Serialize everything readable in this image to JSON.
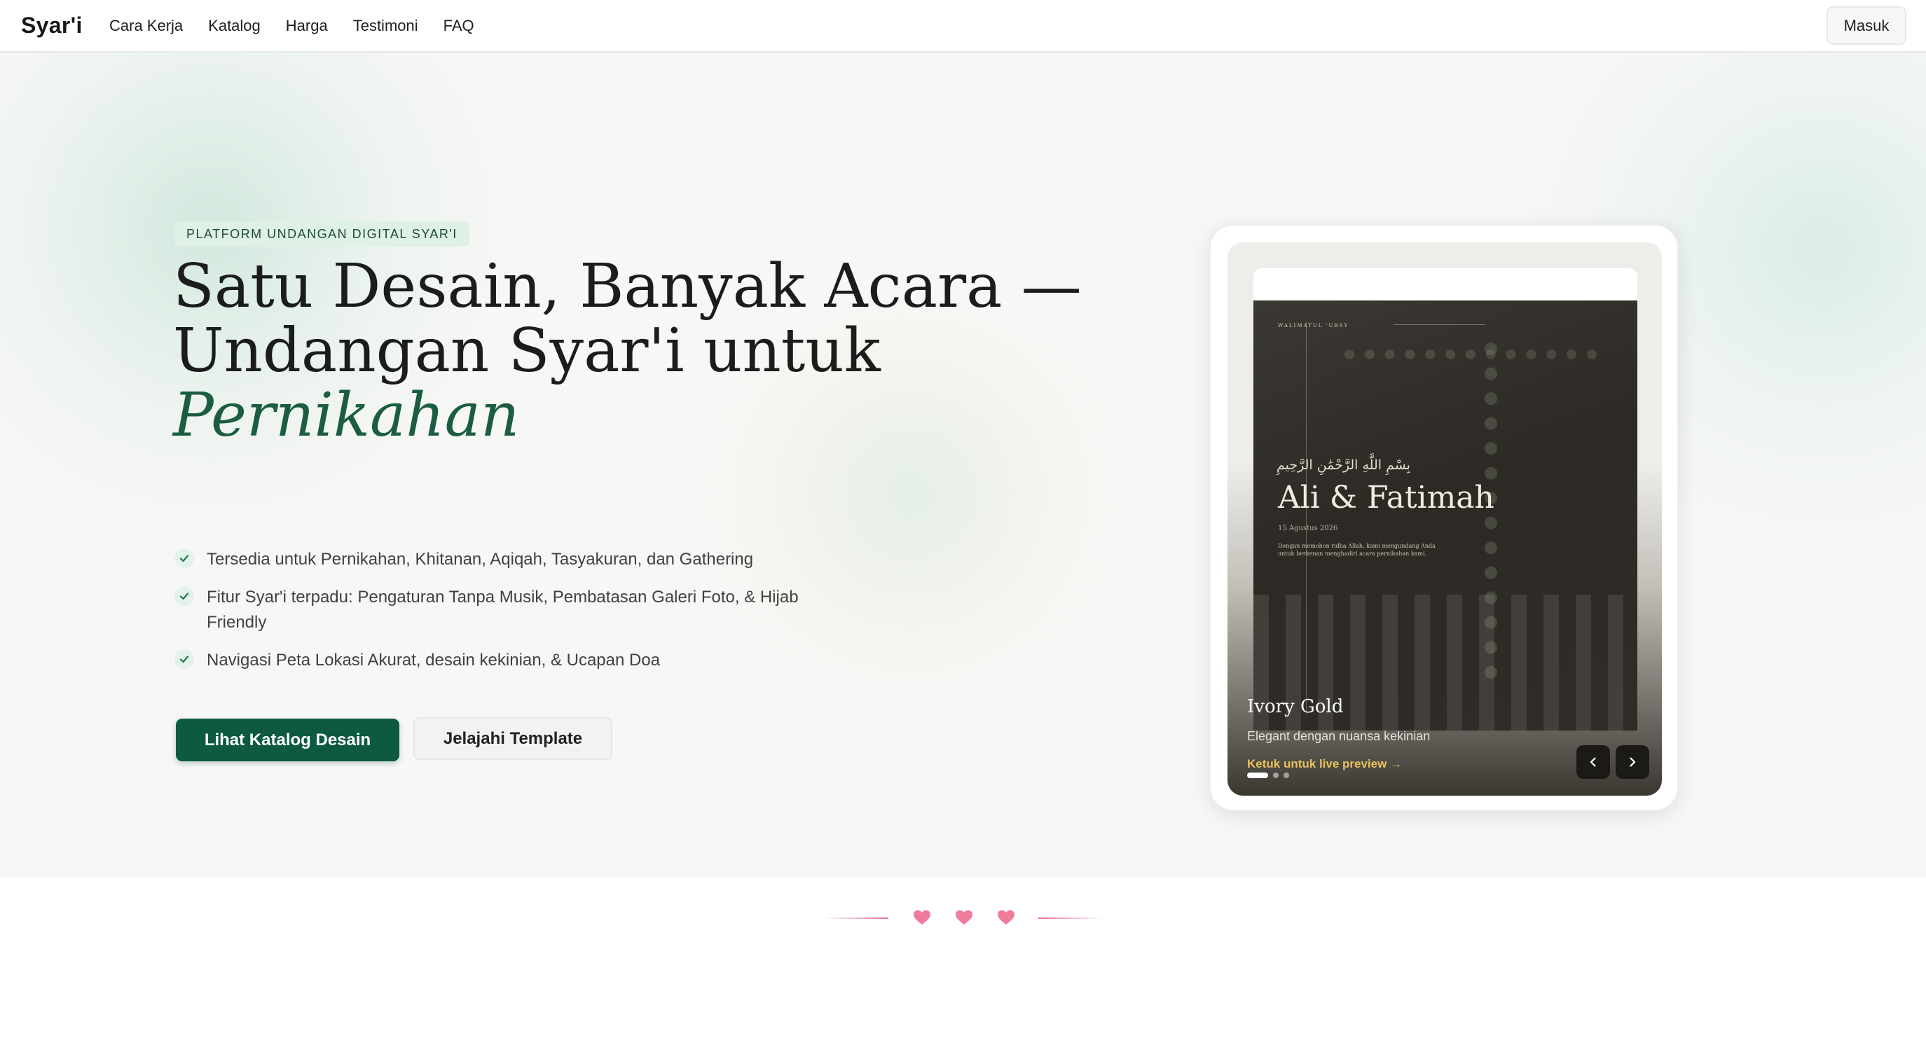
{
  "nav": {
    "brand": "Syar'i",
    "links": [
      "Cara Kerja",
      "Katalog",
      "Harga",
      "Testimoni",
      "FAQ"
    ],
    "login_label": "Masuk"
  },
  "hero": {
    "badge": "PLATFORM UNDANGAN DIGITAL SYAR'I",
    "headline_line1": "Satu Desain, Banyak Acara —",
    "headline_line2": "Undangan Syar'i untuk",
    "headline_accent": "Pernikahan",
    "features": [
      "Tersedia untuk Pernikahan, Khitanan, Aqiqah, Tasyakuran, dan Gathering",
      "Fitur Syar'i terpadu: Pengaturan Tanpa Musik, Pembatasan Galeri Foto, & Hijab Friendly",
      "Navigasi Peta Lokasi Akurat, desain kekinian, & Ucapan Doa"
    ],
    "primary_button": "Lihat Katalog Desain",
    "secondary_button": "Jelajahi Template"
  },
  "preview": {
    "invitation": {
      "subtitle": "WALIMATUL 'URSY",
      "arabic": "بِسْمِ اللَّهِ الرَّحْمَٰنِ الرَّحِيمِ",
      "names": "Ali & Fatimah",
      "date": "15 Agustus 2026",
      "text": "Dengan memohon ridha Allah, kami mengundang Anda untuk berkenan menghadiri acara pernikahan kami."
    },
    "template_name": "Ivory Gold",
    "template_desc": "Elegant dengan nuansa kekinian",
    "preview_link": "Ketuk untuk live preview →",
    "active_slide": 1,
    "slide_count": 3
  },
  "colors": {
    "primary": "#0e5a41",
    "accent_text": "#1b5d43",
    "badge_bg": "#dff1e7",
    "link_gold": "#e7c15b",
    "heart": "#f07c9c"
  },
  "icons": {
    "feature": "check-icon",
    "prev": "chevron-left-icon",
    "next": "chevron-right-icon",
    "divider": "heart-icon"
  }
}
